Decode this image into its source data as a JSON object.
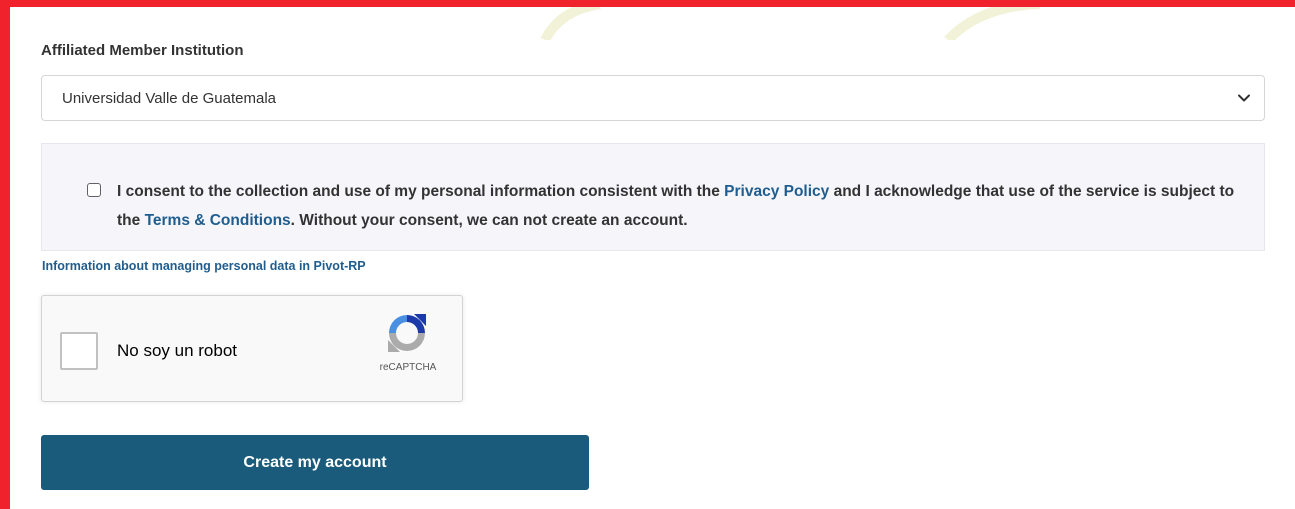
{
  "form": {
    "institution_label": "Affiliated Member Institution",
    "institution_value": "Universidad Valle de Guatemala",
    "consent": {
      "text_before_privacy": "I consent to the collection and use of my personal information consistent with the ",
      "privacy_link": "Privacy Policy",
      "text_between": " and I acknowledge that use of the service is subject to the ",
      "terms_link": "Terms & Conditions",
      "text_after_terms": ". Without your consent, we can not create an account.",
      "checked": false
    },
    "data_info_link": "Information about managing personal data in Pivot-RP",
    "recaptcha": {
      "label": "No soy un robot",
      "brand": "reCAPTCHA",
      "checked": false
    },
    "submit_label": "Create my account"
  },
  "colors": {
    "frame_border": "#f0232d",
    "link": "#1f5d8f",
    "button": "#1a5b7c",
    "consent_bg": "#f5f5fa"
  },
  "icons": {
    "select": "chevron-down-icon",
    "recaptcha": "recaptcha-logo-icon"
  }
}
